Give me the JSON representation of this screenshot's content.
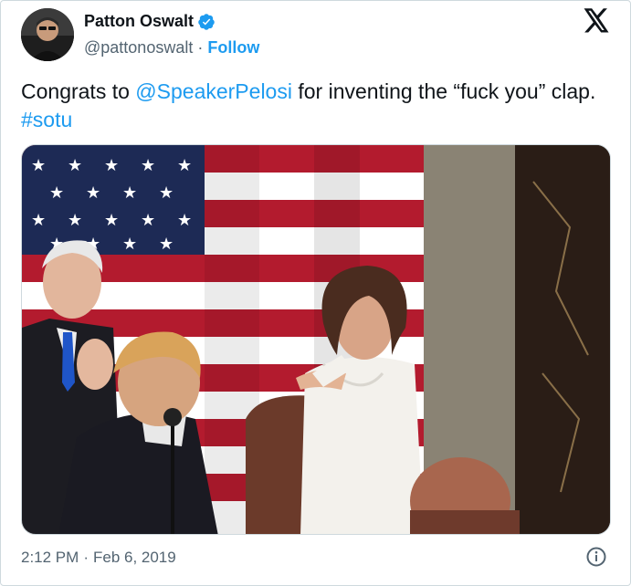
{
  "author": {
    "name": "Patton Oswalt",
    "handle": "@pattonoswalt",
    "follow_label": "Follow",
    "verified": true
  },
  "tweet": {
    "text_before": "Congrats to ",
    "mention": "@SpeakerPelosi",
    "text_after": " for inventing the “fuck you” clap. ",
    "hashtag": "#sotu"
  },
  "meta": {
    "time": "2:12 PM",
    "separator": "·",
    "date": "Feb 6, 2019"
  },
  "icons": {
    "verified": "verified-badge-icon",
    "x_logo": "x-logo-icon",
    "info": "info-icon"
  },
  "colors": {
    "accent": "#1d9bf0",
    "text": "#0f1419",
    "muted": "#536471",
    "border": "#cfd9de"
  }
}
